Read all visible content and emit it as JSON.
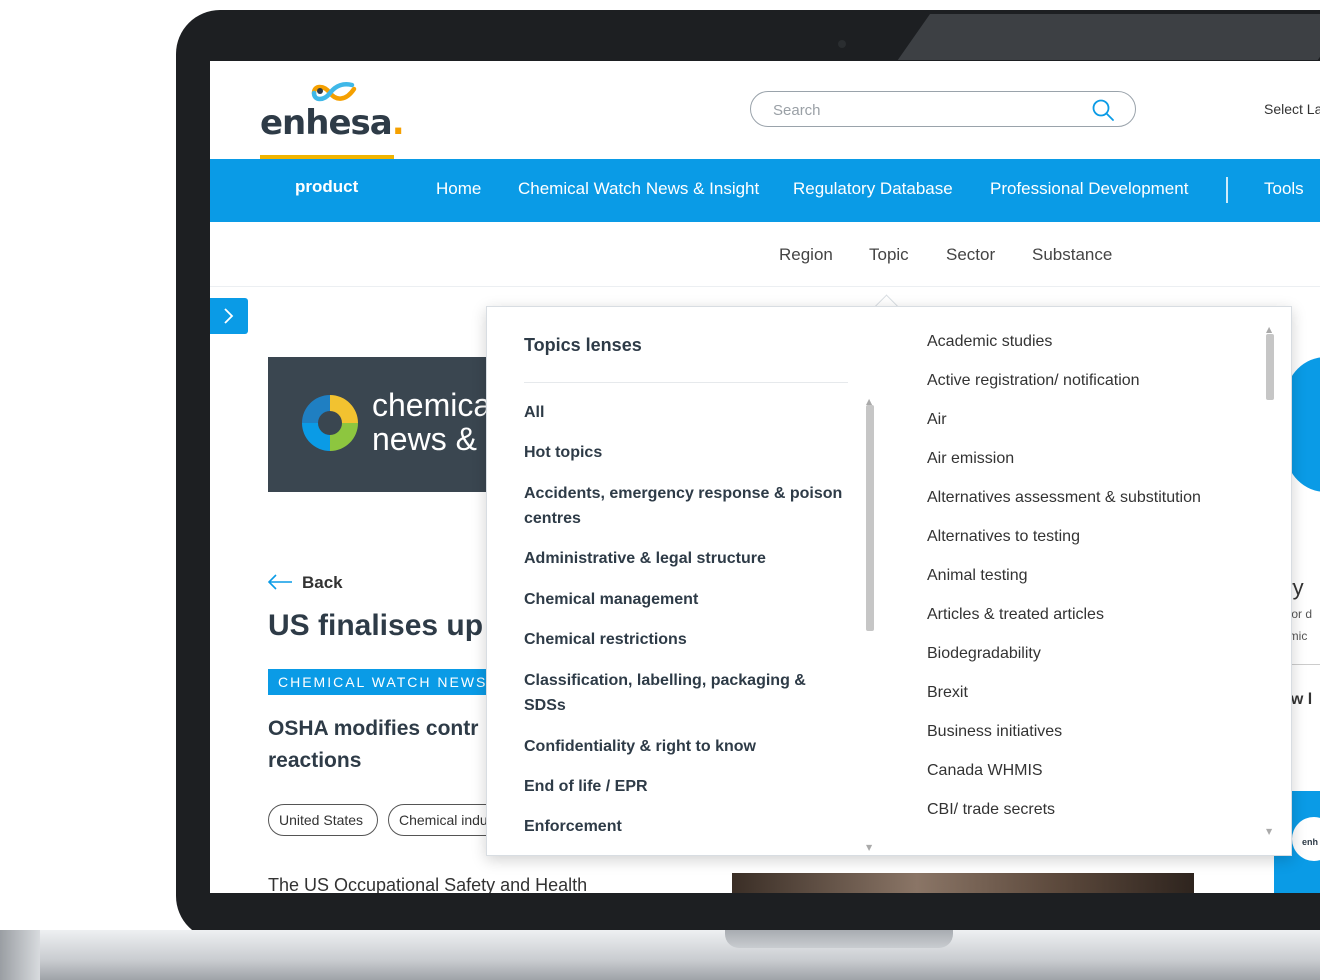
{
  "header": {
    "logo_text": "enhesa",
    "logo_dot": ".",
    "search_placeholder": "Search",
    "select_language": "Select La"
  },
  "nav": {
    "product": "product",
    "items": [
      "Home",
      "Chemical Watch News & Insight",
      "Regulatory Database",
      "Professional Development",
      "Tools"
    ]
  },
  "subnav": [
    "Region",
    "Topic",
    "Sector",
    "Substance"
  ],
  "banner": {
    "line1": "chemica",
    "line2": "news & i"
  },
  "article": {
    "back_label": "Back",
    "headline": "US finalises up",
    "badge": "CHEMICAL WATCH NEWS",
    "subhead_line1": "OSHA modifies contr",
    "subhead_line2": "reactions",
    "tags": [
      "United States",
      "Chemical indu"
    ],
    "body": "The US Occupational Safety and Health"
  },
  "right_column": {
    "text1": "rry",
    "text2": "nior d",
    "text3": "emic",
    "text4": "ew l",
    "card_text": "enh"
  },
  "dropdown": {
    "title": "Topics lenses",
    "lenses": [
      "All",
      "Hot topics",
      "Accidents, emergency response & poison centres",
      "Administrative & legal structure",
      "Chemical management",
      "Chemical restrictions",
      "Classification, labelling, packaging & SDSs",
      "Confidentiality & right to know",
      "End of life / EPR",
      "Enforcement"
    ],
    "topics": [
      "Academic studies",
      "Active registration/ notification",
      "Air",
      "Air emission",
      "Alternatives assessment & substitution",
      "Alternatives to testing",
      "Animal testing",
      "Articles & treated articles",
      "Biodegradability",
      "Brexit",
      "Business initiatives",
      "Canada WHMIS",
      "CBI/ trade secrets"
    ]
  }
}
